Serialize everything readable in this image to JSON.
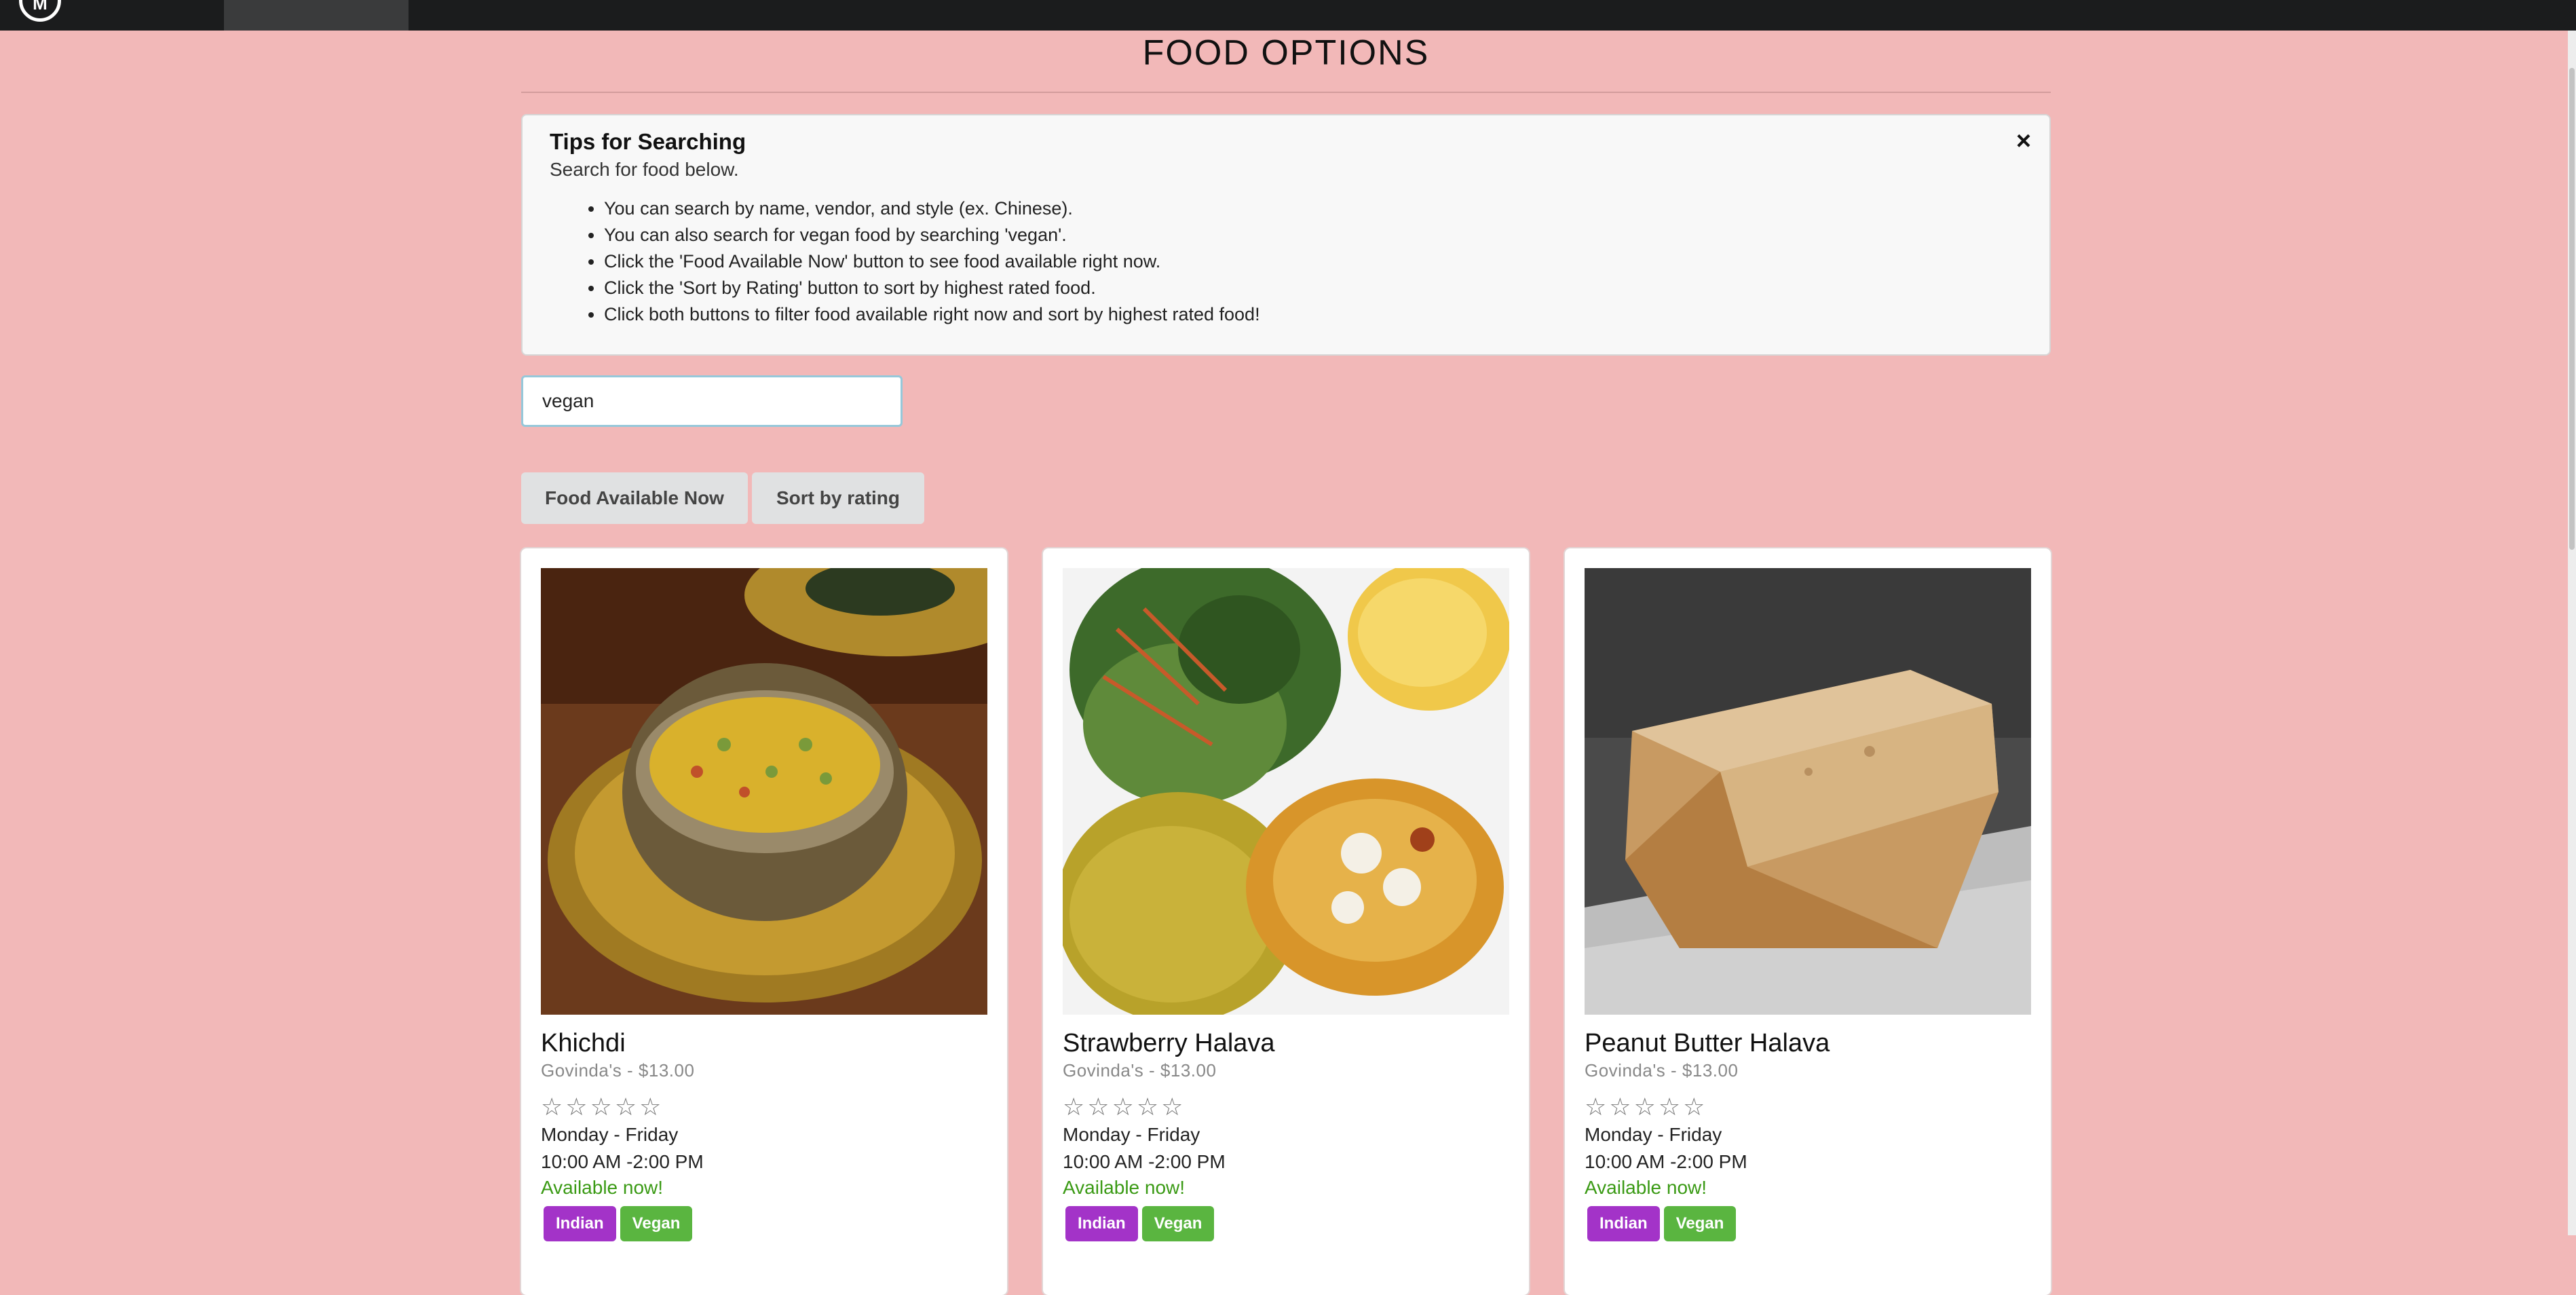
{
  "nav": {
    "logo_text": "M"
  },
  "page_title": "FOOD OPTIONS",
  "tips": {
    "header": "Tips for Searching",
    "subheader": "Search for food below.",
    "items": [
      "You can search by name, vendor, and style (ex. Chinese).",
      "You can also search for vegan food by searching 'vegan'.",
      "Click the 'Food Available Now' button to see food available right now.",
      "Click the 'Sort by Rating' button to sort by highest rated food.",
      "Click both buttons to filter food available right now and sort by highest rated food!"
    ],
    "close_icon": "close-icon"
  },
  "search": {
    "value": "vegan"
  },
  "buttons": {
    "available_now": "Food Available Now",
    "sort_by_rating": "Sort by rating"
  },
  "cards": [
    {
      "title": "Khichdi",
      "meta": "Govinda's - $13.00",
      "stars": [
        "☆",
        "☆",
        "☆",
        "☆",
        "☆"
      ],
      "rating": 0,
      "days": "Monday - Friday",
      "hours": "10:00 AM -2:00 PM",
      "status": "Available now!",
      "tags": [
        "Indian",
        "Vegan"
      ]
    },
    {
      "title": "Strawberry Halava",
      "meta": "Govinda's - $13.00",
      "stars": [
        "☆",
        "☆",
        "☆",
        "☆",
        "☆"
      ],
      "rating": 0,
      "days": "Monday - Friday",
      "hours": "10:00 AM -2:00 PM",
      "status": "Available now!",
      "tags": [
        "Indian",
        "Vegan"
      ]
    },
    {
      "title": "Peanut Butter Halava",
      "meta": "Govinda's - $13.00",
      "stars": [
        "☆",
        "☆",
        "☆",
        "☆",
        "☆"
      ],
      "rating": 0,
      "days": "Monday - Friday",
      "hours": "10:00 AM -2:00 PM",
      "status": "Available now!",
      "tags": [
        "Indian",
        "Vegan"
      ]
    }
  ],
  "colors": {
    "background": "#f2b8b8",
    "navbar": "#1b1c1d",
    "available": "#3a9a14",
    "tag_indian": "#a333c8",
    "tag_vegan": "#5ab540"
  }
}
